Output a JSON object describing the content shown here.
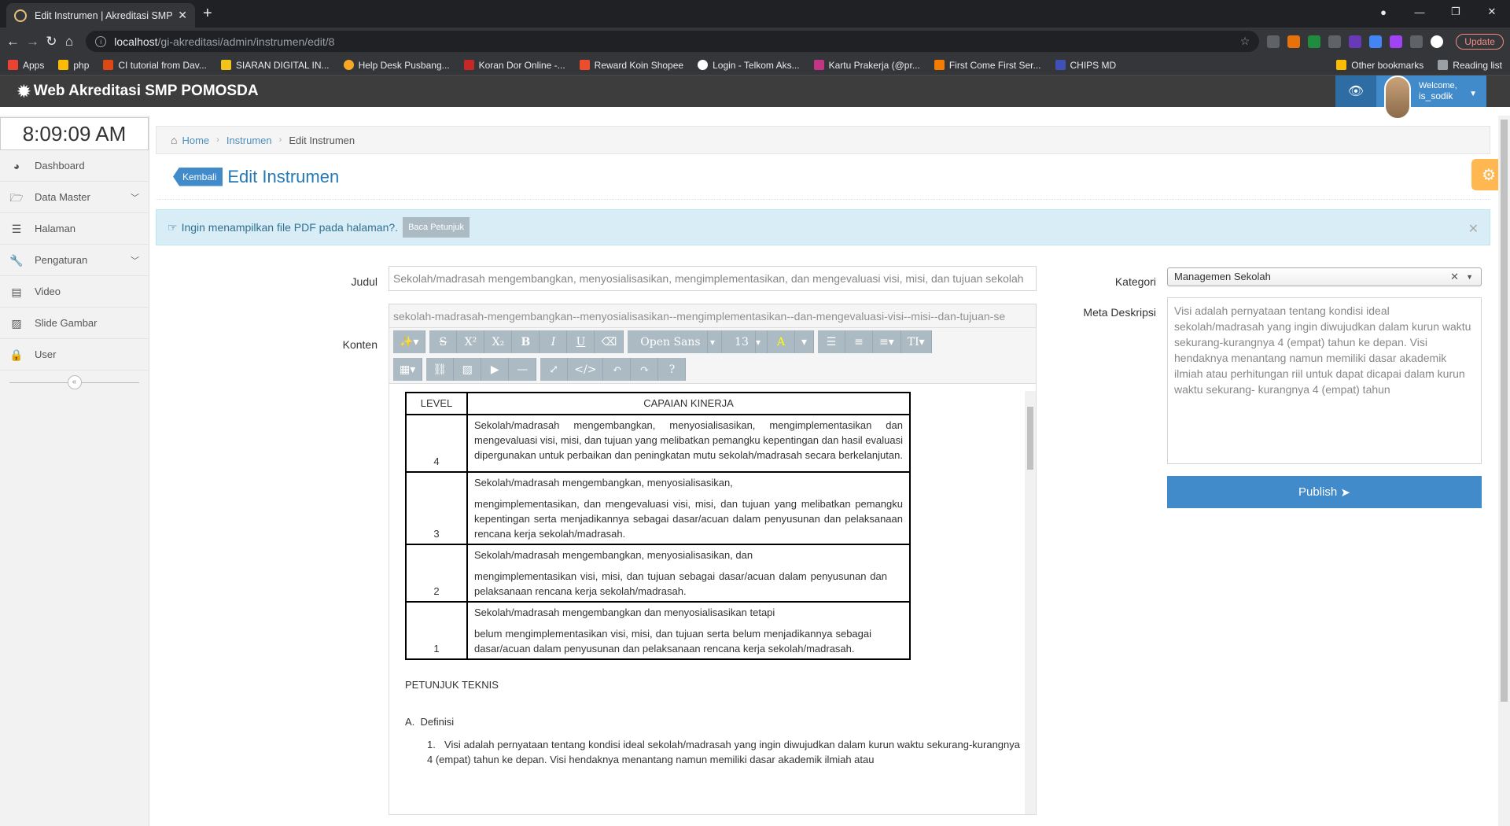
{
  "browser": {
    "tab_title": "Edit Instrumen | Akreditasi SMP F",
    "url_host": "localhost",
    "url_path": "/gi-akreditasi/admin/instrumen/edit/8",
    "update_label": "Update",
    "bookmarks": [
      "Apps",
      "php",
      "CI tutorial from Dav...",
      "SIARAN DIGITAL IN...",
      "Help Desk Pusbang...",
      "Koran Dor Online -...",
      "Reward Koin Shopee",
      "Login - Telkom Aks...",
      "Kartu Prakerja (@pr...",
      "First Come First Ser...",
      "CHIPS MD"
    ],
    "other_bookmarks": "Other bookmarks",
    "reading_list": "Reading list"
  },
  "app": {
    "brand": "Web Akreditasi SMP POMOSDA",
    "welcome": "Welcome,",
    "username": "is_sodik"
  },
  "sidebar": {
    "clock": "8:09:09 AM",
    "items": [
      {
        "label": "Dashboard"
      },
      {
        "label": "Data Master"
      },
      {
        "label": "Halaman"
      },
      {
        "label": "Pengaturan"
      },
      {
        "label": "Video"
      },
      {
        "label": "Slide Gambar"
      },
      {
        "label": "User"
      }
    ]
  },
  "breadcrumb": {
    "home": "Home",
    "section": "Instrumen",
    "current": "Edit Instrumen"
  },
  "header": {
    "back": "Kembali",
    "title": "Edit Instrumen"
  },
  "alert": {
    "text": "Ingin menampilkan file PDF pada halaman?.",
    "button": "Baca Petunjuk"
  },
  "form": {
    "judul_label": "Judul",
    "judul_value": "Sekolah/madrasah mengembangkan, menyosialisasikan, mengimplementasikan, dan mengevaluasi visi, misi, dan tujuan sekolah",
    "slug_value": "sekolah-madrasah-mengembangkan--menyosialisasikan--mengimplementasikan--dan-mengevaluasi-visi--misi--dan-tujuan-se",
    "konten_label": "Konten",
    "kategori_label": "Kategori",
    "kategori_value": "Managemen Sekolah",
    "meta_label": "Meta Deskripsi",
    "meta_value": "Visi adalah pernyataan tentang kondisi ideal sekolah/madrasah yang ingin diwujudkan dalam kurun waktu sekurang-kurangnya 4 (empat) tahun ke depan. Visi hendaknya menantang namun memiliki dasar akademik ilmiah atau perhitungan riil untuk dapat dicapai dalam kurun waktu sekurang- kurangnya 4 (empat) tahun",
    "publish": "Publish"
  },
  "editor": {
    "font": "Open Sans",
    "size": "13",
    "table_header": {
      "level": "LEVEL",
      "capaian": "CAPAIAN KINERJA"
    },
    "rows": [
      {
        "level": "4",
        "p1": "Sekolah/madrasah mengembangkan, menyosialisasikan, mengimplementasikan dan mengevaluasi visi, misi, dan tujuan yang melibatkan pemangku kepentingan dan hasil evaluasi dipergunakan untuk perbaikan dan peningkatan mutu sekolah/madrasah secara berkelanjutan.",
        "p2": ""
      },
      {
        "level": "3",
        "p1": "Sekolah/madrasah mengembangkan, menyosialisasikan,",
        "p2": "mengimplementasikan, dan mengevaluasi visi, misi, dan tujuan yang melibatkan pemangku kepentingan serta menjadikannya sebagai dasar/acuan dalam penyusunan dan pelaksanaan rencana kerja sekolah/madrasah."
      },
      {
        "level": "2",
        "p1": "Sekolah/madrasah mengembangkan, menyosialisasikan, dan",
        "p2": "mengimplementasikan visi, misi, dan tujuan sebagai dasar/acuan dalam penyusunan dan pelaksanaan rencana kerja sekolah/madrasah."
      },
      {
        "level": "1",
        "p1": "Sekolah/madrasah mengembangkan dan menyosialisasikan tetapi",
        "p2": "belum mengimplementasikan visi, misi, dan tujuan serta belum menjadikannya sebagai dasar/acuan dalam penyusunan dan pelaksanaan rencana kerja sekolah/madrasah."
      }
    ],
    "petunjuk": "PETUNJUK TEKNIS",
    "definisi": "A.  Definisi",
    "item1": "1.   Visi adalah pernyataan tentang kondisi ideal sekolah/madrasah yang ingin diwujudkan dalam kurun waktu sekurang-kurangnya 4 (empat) tahun ke depan. Visi hendaknya menantang namun memiliki dasar akademik ilmiah atau"
  }
}
